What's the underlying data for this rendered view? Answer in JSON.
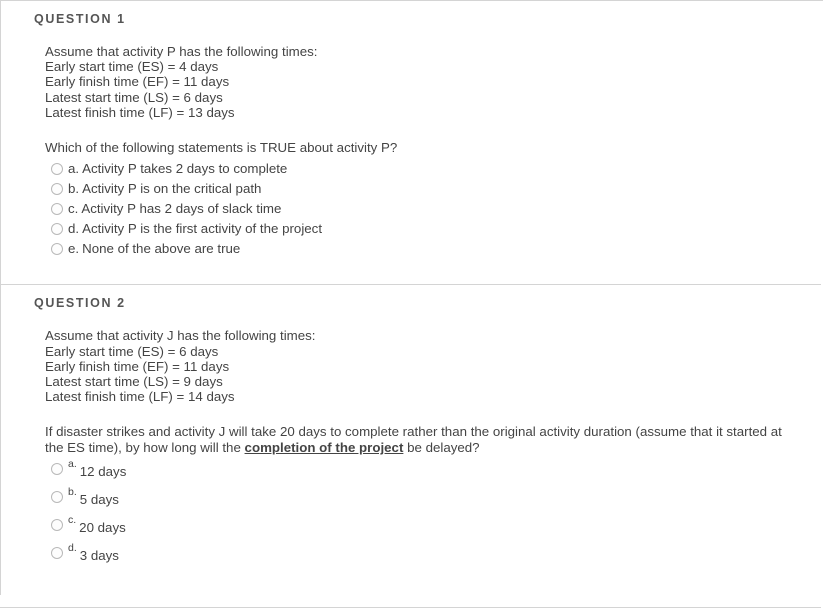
{
  "questions": [
    {
      "heading": "QUESTION 1",
      "statement_lines": [
        "Assume that activity P has the following times:",
        "Early start time (ES) = 4 days",
        "Early finish time (EF) = 11 days",
        "Latest start time (LS) = 6 days",
        "Latest finish time (LF) = 13 days"
      ],
      "prompt": "Which of the following statements is TRUE about activity P?",
      "options": [
        {
          "letter": "a.",
          "text": "Activity P takes 2 days to complete"
        },
        {
          "letter": "b.",
          "text": "Activity P is on the critical path"
        },
        {
          "letter": "c.",
          "text": "Activity P has 2 days of slack time"
        },
        {
          "letter": "d.",
          "text": "Activity P is the first activity of the project"
        },
        {
          "letter": "e.",
          "text": "None of the above are true"
        }
      ]
    },
    {
      "heading": "QUESTION 2",
      "statement_lines": [
        "Assume that activity J has the following times:",
        "Early start time (ES) = 6 days",
        "Early finish time (EF) = 11 days",
        "Latest start time (LS) = 9 days",
        "Latest finish time (LF) = 14 days"
      ],
      "prompt_part1": "If disaster strikes and activity J will take 20 days to complete rather than the original activity duration (assume that it started at the ES time), by how long will the ",
      "prompt_emphasis": "completion of the project",
      "prompt_part2": " be delayed?",
      "options": [
        {
          "letter": "a.",
          "text": "12 days"
        },
        {
          "letter": "b.",
          "text": "5 days"
        },
        {
          "letter": "c.",
          "text": "20 days"
        },
        {
          "letter": "d.",
          "text": "3 days"
        }
      ]
    }
  ],
  "colors": {
    "border": "#d4d4d4",
    "heading_text": "#555555",
    "body_text": "#444444",
    "radio_border": "#b9b9b9"
  }
}
